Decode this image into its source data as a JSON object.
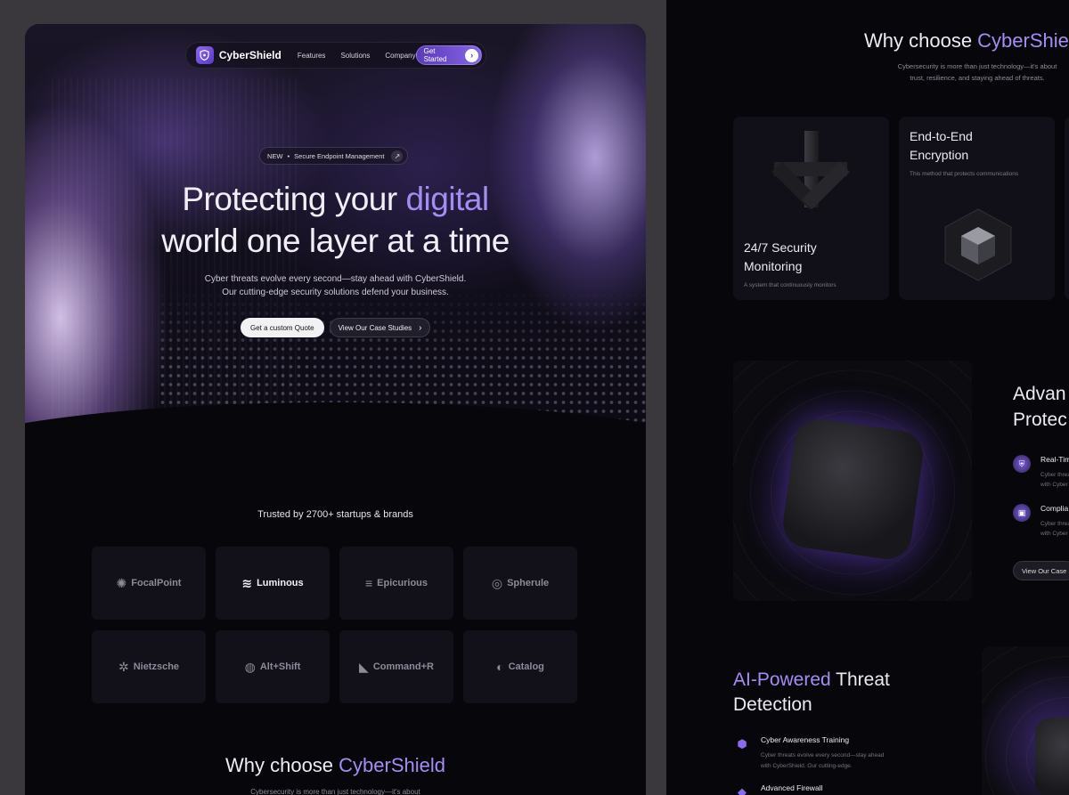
{
  "nav": {
    "brand": "CyberShield",
    "links": [
      "Features",
      "Solutions",
      "Company"
    ],
    "cta": "Get Started"
  },
  "hero": {
    "pill_new": "NEW",
    "pill_text": "Secure Endpoint Management",
    "title_line1_pre": "Protecting your ",
    "title_line1_accent": "digital",
    "title_line2": "world one layer at a time",
    "sub_line1": "Cyber threats evolve every second—stay ahead with CyberShield.",
    "sub_line2": "Our cutting-edge security solutions defend your business.",
    "primary_btn": "Get a custom Quote",
    "secondary_btn": "View Our Case Studies"
  },
  "trusted": {
    "heading": "Trusted by 2700+ startups & brands",
    "logos": [
      {
        "name": "FocalPoint",
        "icon": "sunburst-icon",
        "glyph": "✺"
      },
      {
        "name": "Luminous",
        "icon": "lightning-icon",
        "glyph": "≋"
      },
      {
        "name": "Epicurious",
        "icon": "stack-icon",
        "glyph": "≡"
      },
      {
        "name": "Spherule",
        "icon": "sphere-icon",
        "glyph": "◎"
      },
      {
        "name": "Nietzsche",
        "icon": "asterisk-icon",
        "glyph": "✲"
      },
      {
        "name": "Alt+Shift",
        "icon": "waves-icon",
        "glyph": "◍"
      },
      {
        "name": "Command+R",
        "icon": "r-mark-icon",
        "glyph": "◣"
      },
      {
        "name": "Catalog",
        "icon": "c-mark-icon",
        "glyph": "◐"
      }
    ]
  },
  "why": {
    "title_pre": "Why choose ",
    "title_accent": "CyberShield",
    "right_title_accent": "CyberShie",
    "sub_line1": "Cybersecurity is more than just technology—it's about",
    "sub_line2": "trust, resilience, and staying ahead of threats.",
    "left_sub": "Cybersecurity is more than just technology—it's about"
  },
  "cards": {
    "monitoring_title_1": "24/7 Security",
    "monitoring_title_2": "Monitoring",
    "monitoring_sub": "A system that continuously monitors",
    "encryption_title_1": "End-to-End",
    "encryption_title_2": "Encryption",
    "encryption_sub": "This method that protects communications"
  },
  "advanced": {
    "title_1": "Advan",
    "title_2": "Protec",
    "item1_name": "Real-Tim",
    "item1_desc_1": "Cyber threa",
    "item1_desc_2": "with Cyber",
    "item2_name": "Complia",
    "item2_desc_1": "Cyber threa",
    "item2_desc_2": "with Cyber",
    "case_btn": "View Our Case S"
  },
  "ai": {
    "title_accent": "AI-Powered",
    "title_rest": " Threat",
    "title_line2": "Detection",
    "item1_name": "Cyber Awareness Training",
    "item1_desc_1": "Cyber threats evolve every second—stay ahead",
    "item1_desc_2": "with CyberShield. Our cutting-edge.",
    "item2_name": "Advanced Firewall"
  },
  "colors": {
    "accent": "#a48cf2",
    "brand_purple": "#6b4bd6",
    "background": "#07060b",
    "canvas": "#3a383d"
  }
}
